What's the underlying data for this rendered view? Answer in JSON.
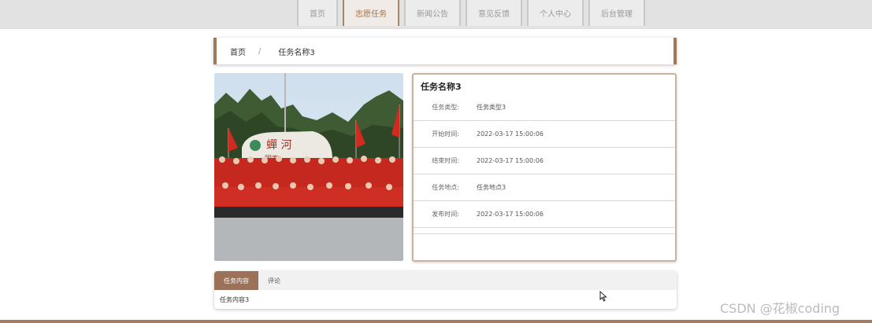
{
  "nav": {
    "items": [
      {
        "label": "首页"
      },
      {
        "label": "志愿任务",
        "active": true
      },
      {
        "label": "新闻公告"
      },
      {
        "label": "意见反馈"
      },
      {
        "label": "个人中心"
      },
      {
        "label": "后台管理"
      }
    ]
  },
  "breadcrumb": {
    "home": "首页",
    "separator": "/",
    "current": "任务名称3"
  },
  "detail": {
    "title": "任务名称3",
    "rows": [
      {
        "label": "任务类型:",
        "value": "任务类型3"
      },
      {
        "label": "开始时间:",
        "value": "2022-03-17 15:00:06"
      },
      {
        "label": "结束时间:",
        "value": "2022-03-17 15:00:06"
      },
      {
        "label": "任务地点:",
        "value": "任务地点3"
      },
      {
        "label": "发布时间:",
        "value": "2022-03-17 15:00:06"
      }
    ]
  },
  "tabs": {
    "items": [
      {
        "label": "任务内容",
        "active": true
      },
      {
        "label": "评论"
      }
    ],
    "content": "任务内容3"
  },
  "watermark": "CSDN @花椒coding",
  "colors": {
    "accent": "#a0785a",
    "tab_active": "#9b7257"
  }
}
